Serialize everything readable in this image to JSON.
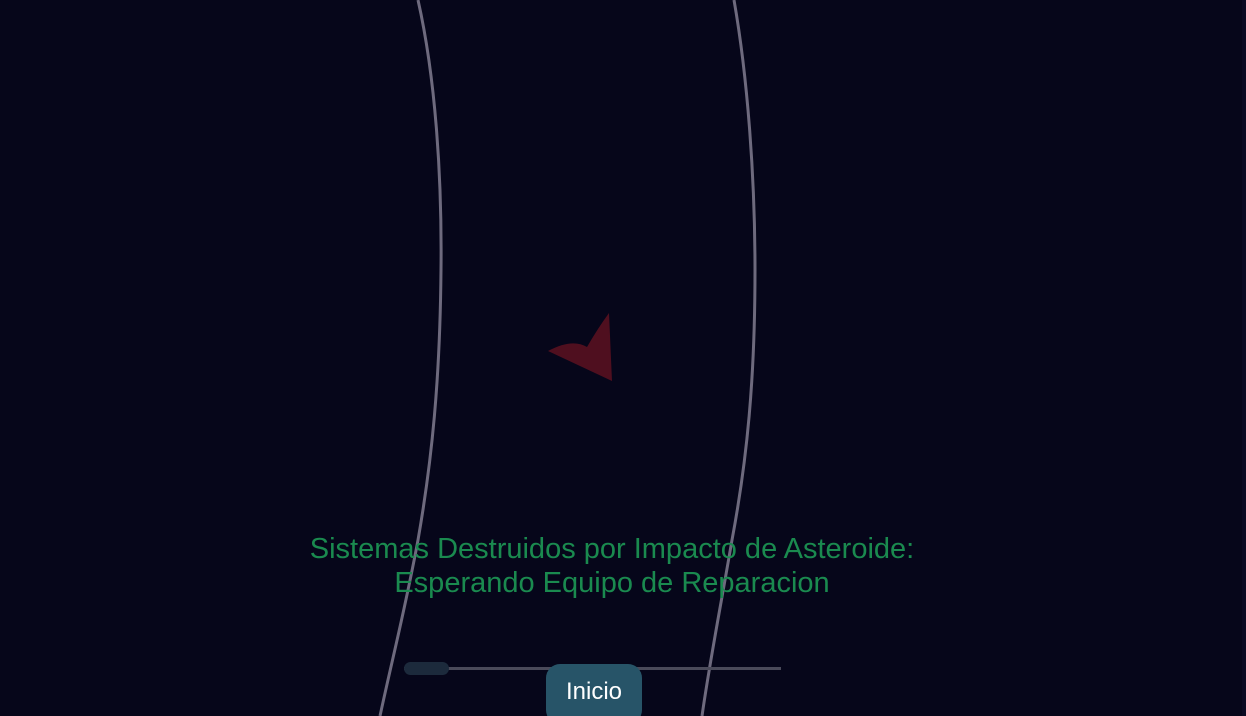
{
  "game": {
    "status_line_1": "Sistemas Destruidos por Impacto de Asteroide:",
    "status_line_2": "Esperando Equipo de Reparacion",
    "start_button_label": "Inicio",
    "repair_progress": 0.12
  },
  "colors": {
    "background": "#06061a",
    "track_line": "#6e6a7e",
    "ship": "#4f0f1f",
    "status_text": "#1a8a4f",
    "button": "#275468",
    "progress_track": "#4a4a5a",
    "progress_fill": "#1c2a3c"
  },
  "icons": {
    "player": "ship-icon"
  }
}
